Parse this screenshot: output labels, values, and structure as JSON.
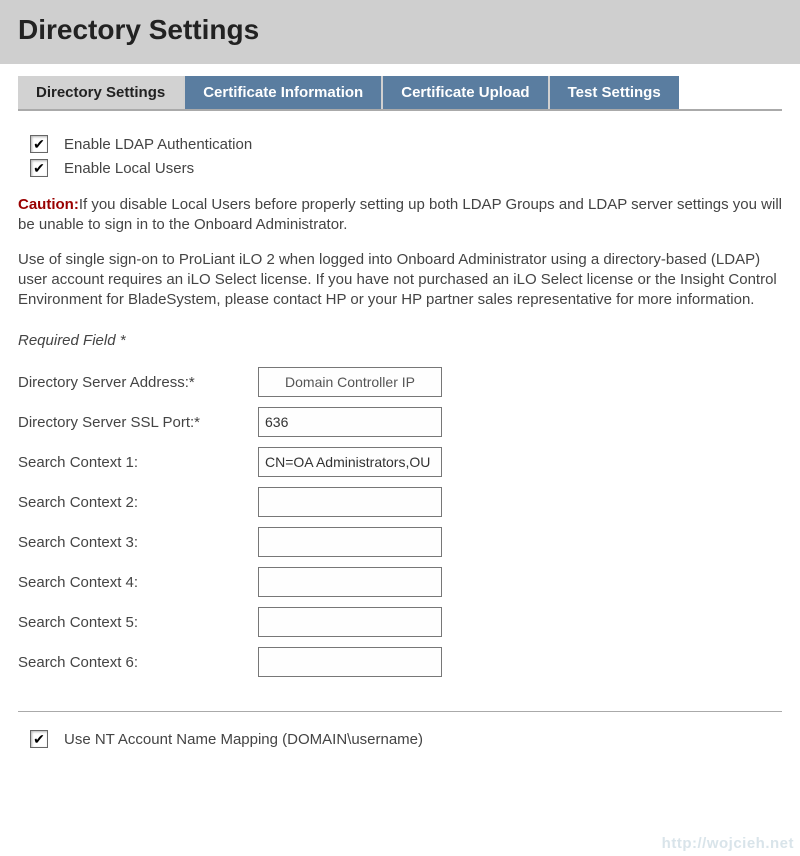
{
  "header": {
    "title": "Directory Settings"
  },
  "tabs": {
    "items": [
      {
        "label": "Directory Settings",
        "active": true
      },
      {
        "label": "Certificate Information",
        "active": false
      },
      {
        "label": "Certificate Upload",
        "active": false
      },
      {
        "label": "Test Settings",
        "active": false
      }
    ]
  },
  "checkboxes": {
    "enable_ldap": {
      "label": "Enable LDAP Authentication",
      "checked": true
    },
    "enable_local_users": {
      "label": "Enable Local Users",
      "checked": true
    },
    "use_nt_mapping": {
      "label": "Use NT Account Name Mapping (DOMAIN\\username)",
      "checked": true
    }
  },
  "caution": {
    "label": "Caution:",
    "text": "If you disable Local Users before properly setting up both LDAP Groups and LDAP server settings you will be unable to sign in to the Onboard Administrator."
  },
  "info_text": "Use of single sign-on to ProLiant iLO 2 when logged into Onboard Administrator using a directory-based (LDAP) user account requires an iLO Select license. If you have not purchased an iLO Select license or the Insight Control Environment for BladeSystem, please contact HP or your HP partner sales representative for more information.",
  "required_field_label": "Required Field *",
  "fields": {
    "server_address": {
      "label": "Directory Server Address:*",
      "value": "Domain Controller IP"
    },
    "ssl_port": {
      "label": "Directory Server SSL Port:*",
      "value": "636"
    },
    "search1": {
      "label": "Search Context 1:",
      "value": "CN=OA Administrators,OU"
    },
    "search2": {
      "label": "Search Context 2:",
      "value": ""
    },
    "search3": {
      "label": "Search Context 3:",
      "value": ""
    },
    "search4": {
      "label": "Search Context 4:",
      "value": ""
    },
    "search5": {
      "label": "Search Context 5:",
      "value": ""
    },
    "search6": {
      "label": "Search Context 6:",
      "value": ""
    }
  },
  "watermark": "http://wojcieh.net"
}
